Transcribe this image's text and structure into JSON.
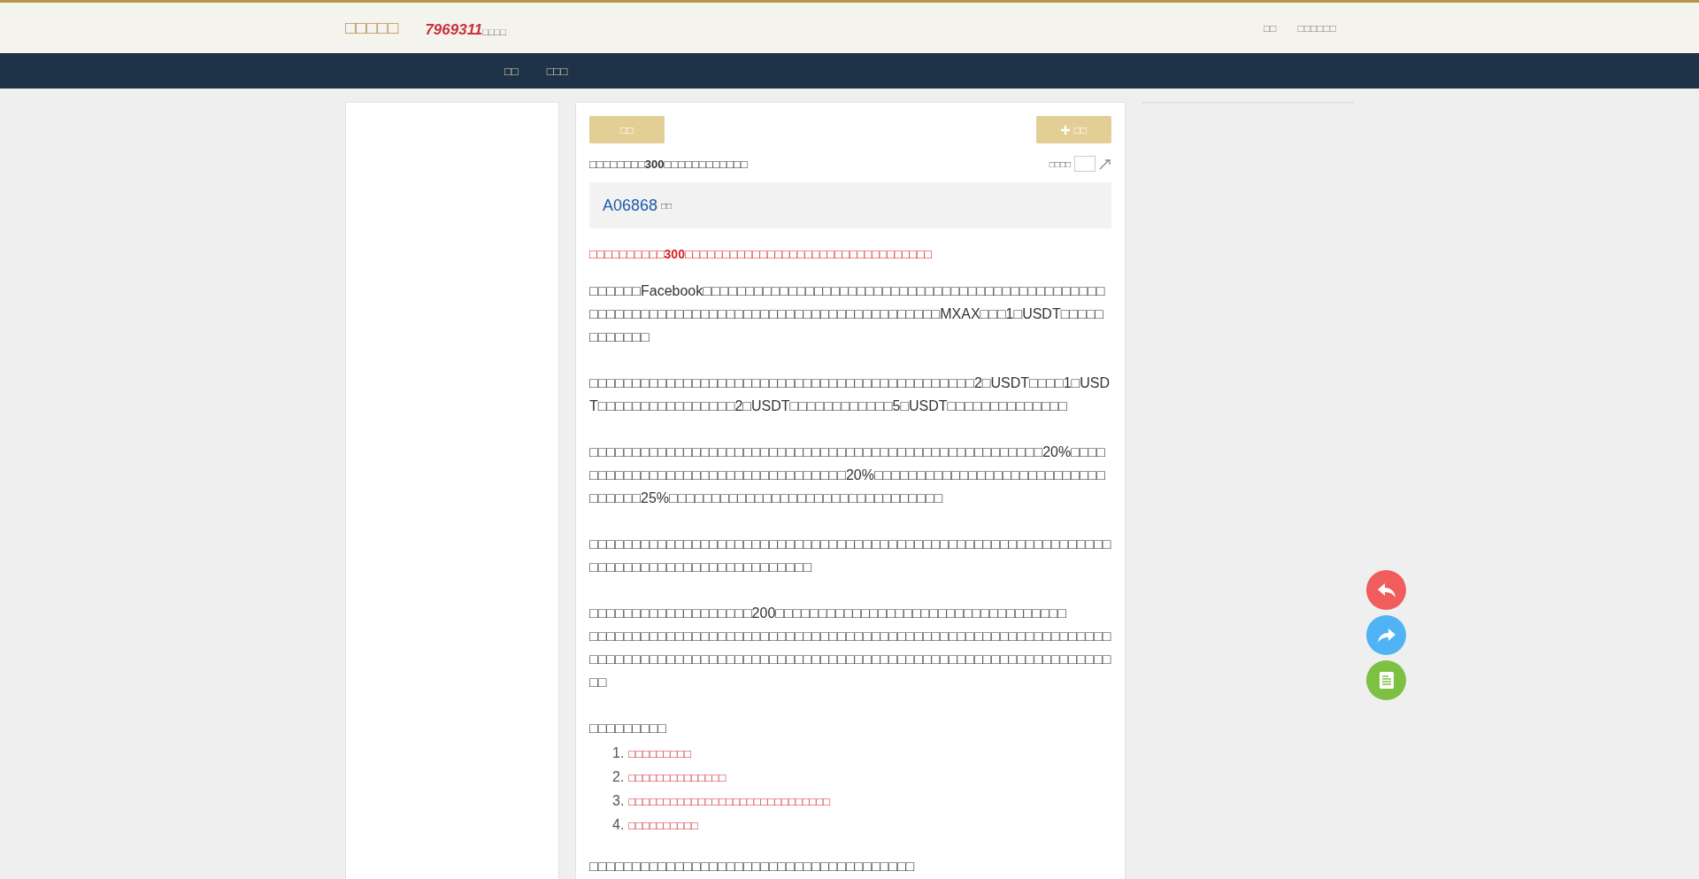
{
  "header": {
    "logo": "□□□□□",
    "number": "7969311",
    "number_suffix": "□□□□",
    "links": [
      "□□",
      "□□□□□□"
    ]
  },
  "nav": [
    "□□",
    "□□□"
  ],
  "toolbar": {
    "left_button": "□□",
    "right_button": "□□"
  },
  "intro": "□□□□□□□□**300**□□□□□□□□□□□□",
  "page_jump": {
    "label": "□□□□"
  },
  "post": {
    "author": "A06868",
    "author_tag": "□□"
  },
  "article": {
    "headline": "□□□□□□□□□□**300**□□□□□□□□□□□□□□□□□□□□□□□□□□□□□□□□□",
    "paragraphs": [
      "□□□□□□Facebook□□□□□□□□□□□□□□□□□□□□□□□□□□□□□□□□□□□□□□□□□□□□□□□□□□□□□□□□□□□□□□□□□□□□□□□□□□□□□□□□□□□□□□□□MXAX□□□1□USDT□□□□□□□□□□□□",
      "□□□□□□□□□□□□□□□□□□□□□□□□□□□□□□□□□□□□□□□□□□□□□2□USDT□□□□1□USDT□□□□□□□□□□□□□□□□2□USDT□□□□□□□□□□□□5□USDT□□□□□□□□□□□□□□",
      "□□□□□□□□□□□□□□□□□□□□□□□□□□□□□□□□□□□□□□□□□□□□□□□□□□□□□20%□□□□□□□□□□□□□□□□□□□□□□□□□□□□□□□□□□20%□□□□□□□□□□□□□□□□□□□□□□□□□□□□□□□□□25%□□□□□□□□□□□□□□□□□□□□□□□□□□□□□□□□",
      "□□□□□□□□□□□□□□□□□□□□□□□□□□□□□□□□□□□□□□□□□□□□□□□□□□□□□□□□□□□□□□□□□□□□□□□□□□□□□□□□□□□□□□□",
      "□□□□□□□□□□□□□□□□□□□200□□□□□□□□□□□□□□□□□□□□□□□□□□□□□□□□□□\n□□□□□□□□□□□□□□□□□□□□□□□□□□□□□□□□□□□□□□□□□□□□□□□□□□□□□□□□□□□□□□□□□□□□□□□□□□□□□□□□□□□□□□□□□□□□□□□□□□□□□□□□□□□□□□□□□□□□□□□□□□□□"
    ],
    "list_intro": "□□□□□□□□□",
    "list": [
      {
        "marker": "1.",
        "text": "□□□□□□□□□"
      },
      {
        "marker": "2.",
        "text": "□□□□□□□□□□□□□□"
      },
      {
        "marker": "3.",
        "text": "□□□□□□□□□□□□□□□□□□□□□□□□□□□□□"
      },
      {
        "marker": "4.",
        "text": "□□□□□□□□□□"
      }
    ],
    "closing": "□□□□□□□□□□□□□□□□□□□□□□□□□□□□□□□□□□□□□□"
  },
  "floating_buttons": [
    {
      "kind": "reply"
    },
    {
      "kind": "forward"
    },
    {
      "kind": "document"
    }
  ]
}
